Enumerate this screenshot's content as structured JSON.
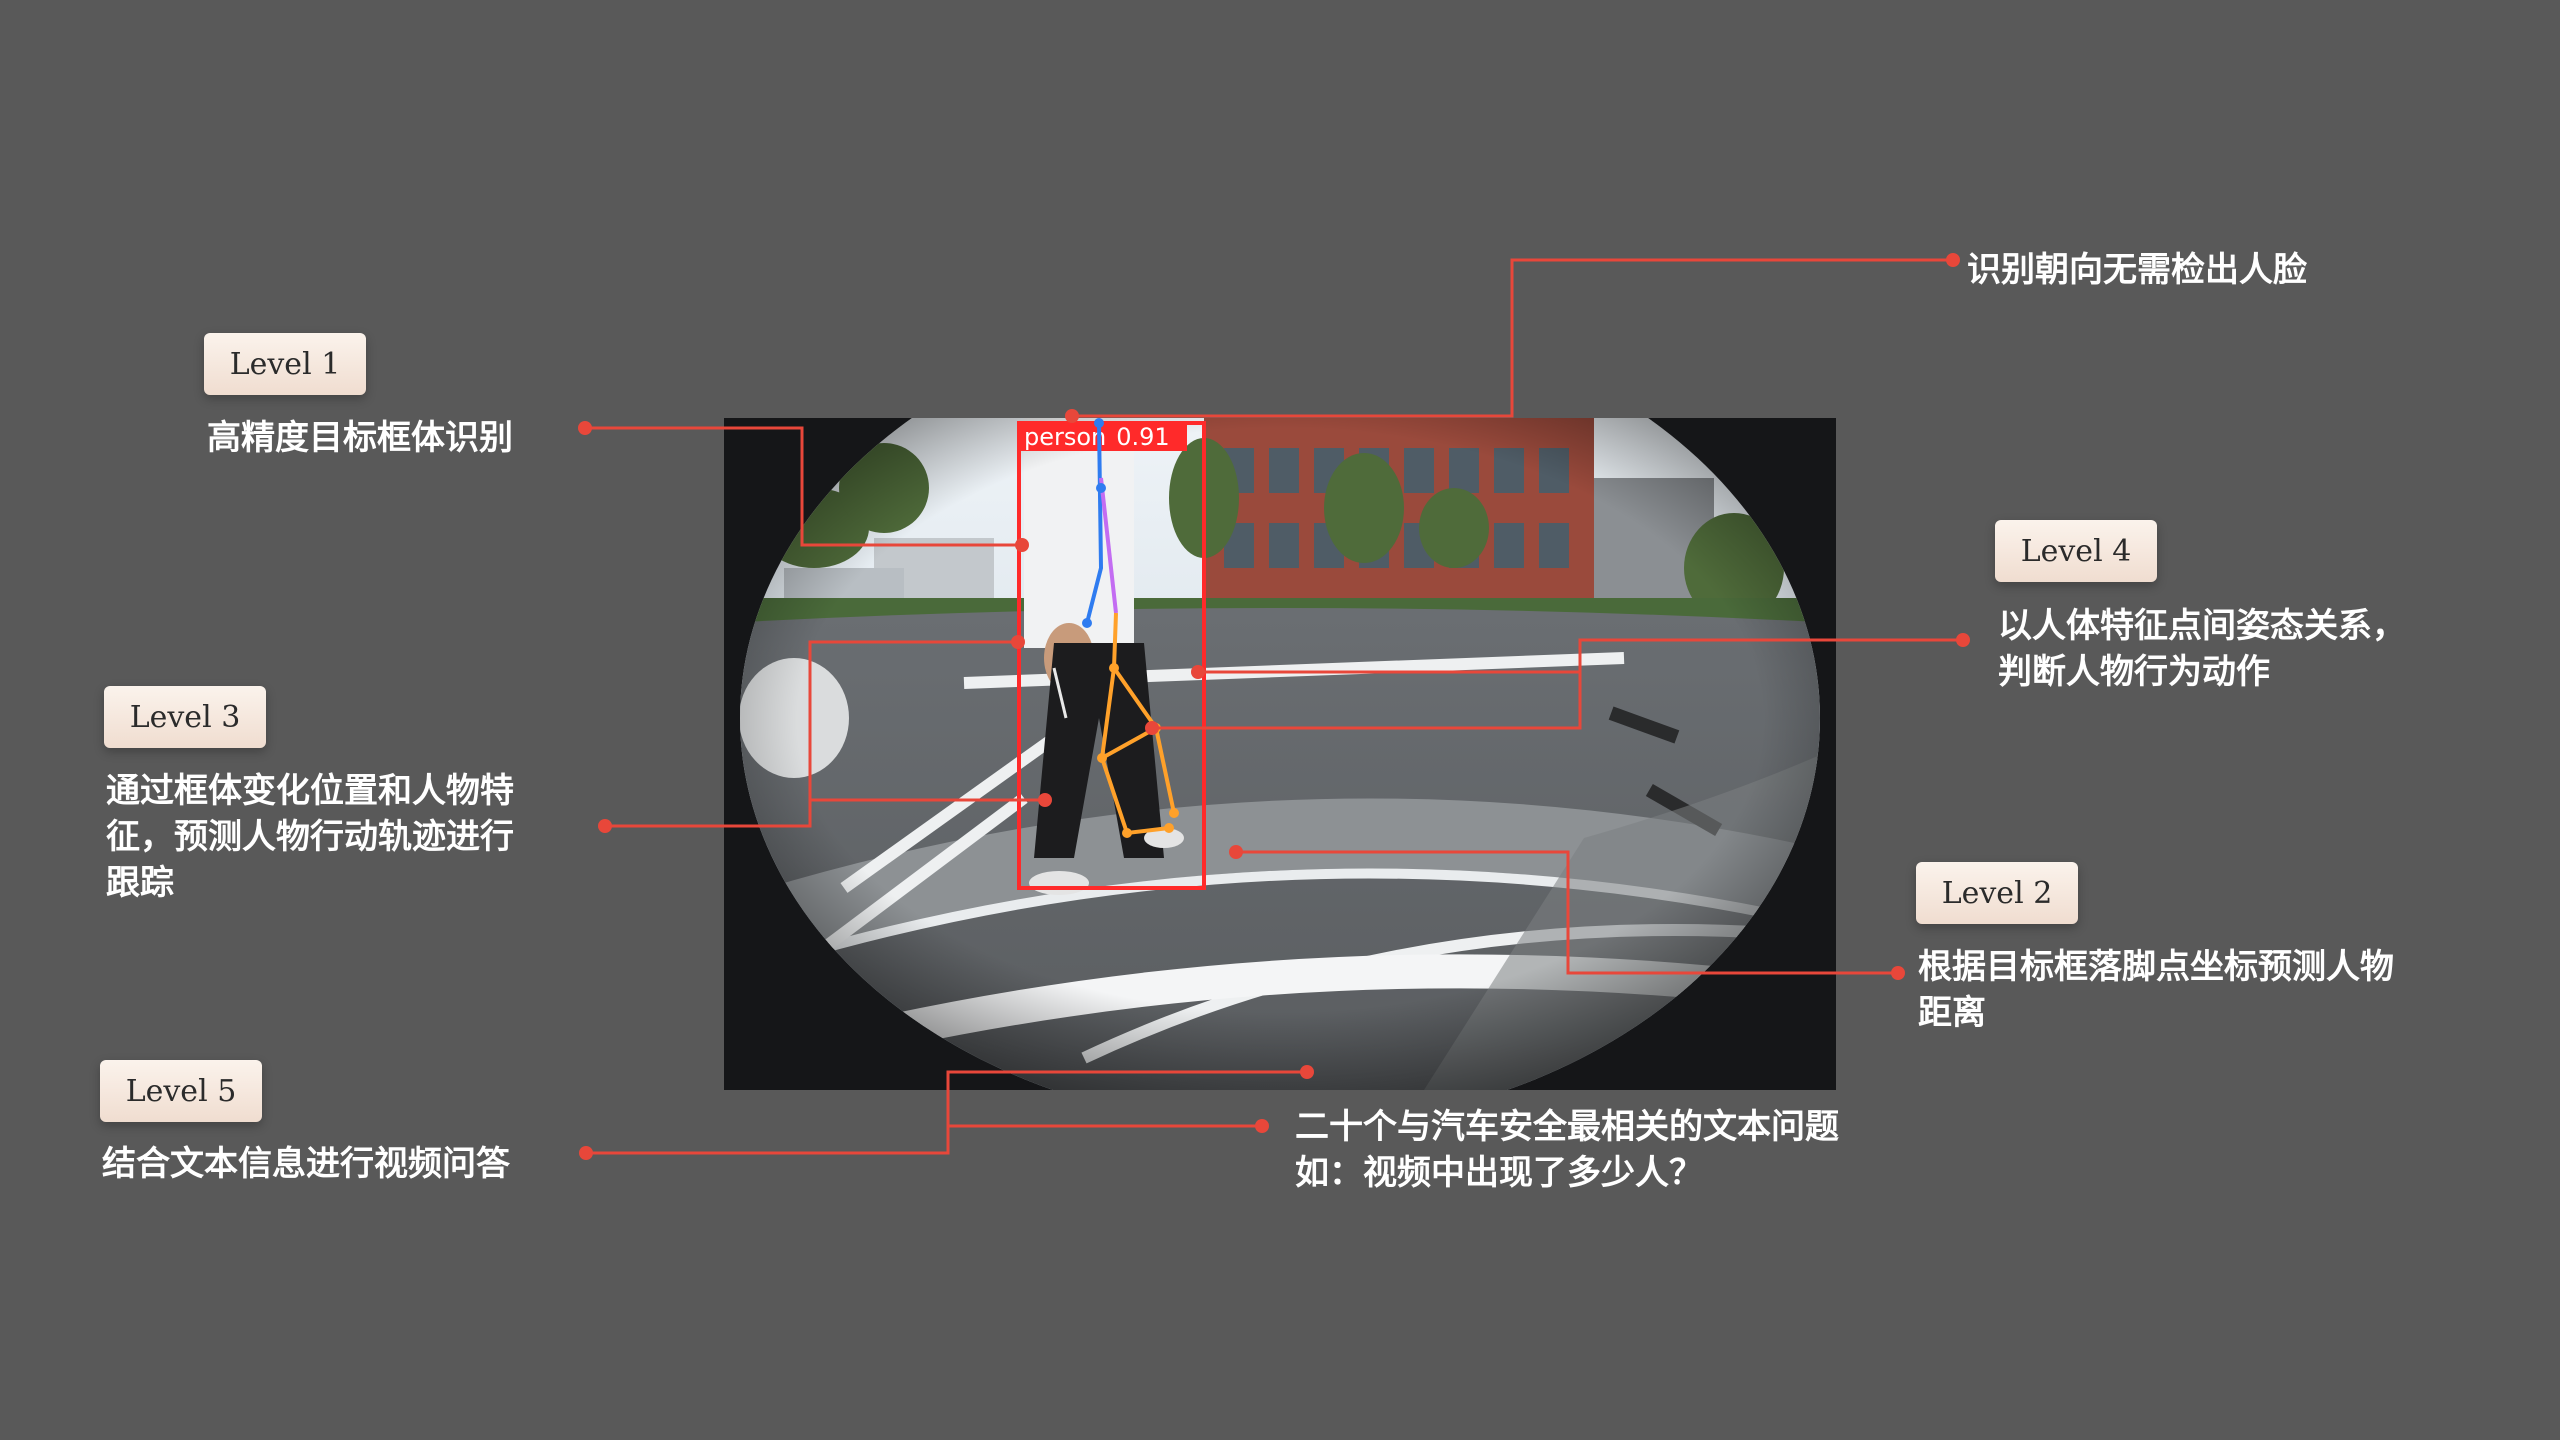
{
  "levels": [
    {
      "badge": "Level 1",
      "caption": [
        "高精度目标框体识别"
      ]
    },
    {
      "badge": "Level 2",
      "caption": [
        "根据目标框落脚点坐标预测人物",
        "距离"
      ]
    },
    {
      "badge": "Level 3",
      "caption": [
        "通过框体变化位置和人物特",
        "征，预测人物行动轨迹进行",
        "跟踪"
      ]
    },
    {
      "badge": "Level 4",
      "caption": [
        "以人体特征点间姿态关系，",
        "判断人物行为动作"
      ]
    },
    {
      "badge": "Level 5",
      "caption": [
        "结合文本信息进行视频问答"
      ]
    }
  ],
  "orientation_note": "识别朝向无需检出人脸",
  "qa_note": [
    "二十个与汽车安全最相关的文本问题",
    "如：视频中出现了多少人？"
  ],
  "detection": {
    "label": "person",
    "score": "0.91"
  },
  "colors": {
    "background": "#595959",
    "leader": "#e8473a",
    "box": "#ff2a2a",
    "badge": "#f6e8de"
  }
}
